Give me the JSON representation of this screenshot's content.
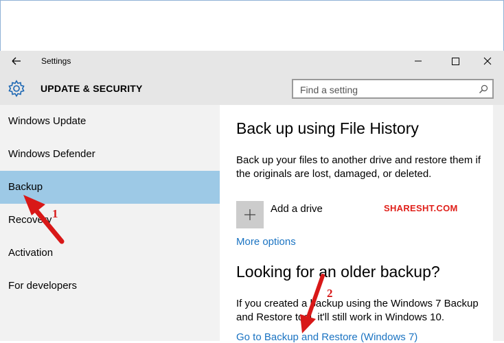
{
  "window": {
    "title": "Settings"
  },
  "header": {
    "title": "UPDATE & SECURITY",
    "search_placeholder": "Find a setting"
  },
  "sidebar": {
    "items": [
      {
        "label": "Windows Update",
        "selected": false
      },
      {
        "label": "Windows Defender",
        "selected": false
      },
      {
        "label": "Backup",
        "selected": true
      },
      {
        "label": "Recovery",
        "selected": false
      },
      {
        "label": "Activation",
        "selected": false
      },
      {
        "label": "For developers",
        "selected": false
      }
    ]
  },
  "main": {
    "file_history_title": "Back up using File History",
    "file_history_desc": "Back up your files to another drive and restore them if the originals are lost, damaged, or deleted.",
    "add_drive_label": "Add a drive",
    "more_options_link": "More options",
    "older_backup_title": "Looking for an older backup?",
    "older_backup_desc": "If you created a backup using the Windows 7 Backup and Restore tool, it'll still work in Windows 10.",
    "backup_restore_link": "Go to Backup and Restore (Windows 7)"
  },
  "annotations": {
    "watermark": "SHARESHT.COM",
    "step1": "1",
    "step2": "2"
  },
  "colors": {
    "titlebar_bg": "#e6e6e6",
    "sidebar_bg": "#f2f2f2",
    "selected_bg": "#9dc9e6",
    "link": "#1a73c2",
    "annotation": "#d81818"
  }
}
